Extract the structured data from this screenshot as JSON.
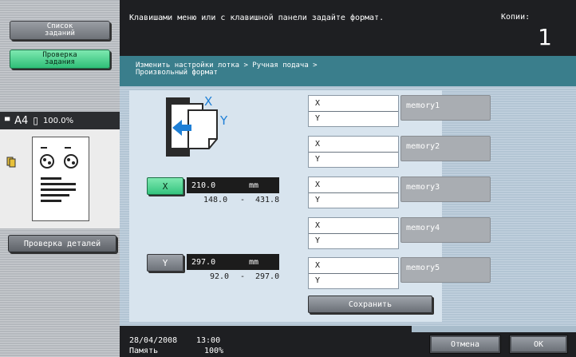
{
  "sidebar": {
    "job_list_label": "Список\nзаданий",
    "job_check_label": "Проверка\nзадания",
    "paper_size": "A4",
    "zoom": "100.0%",
    "details_label": "Проверка деталей"
  },
  "header": {
    "message": "Клавишами меню или с клавишной панели задайте формат.",
    "copies_label": "Копии:",
    "copies_value": "1"
  },
  "breadcrumb": {
    "line1": "Изменить настройки лотка > Ручная подача >",
    "line2": "Произвольный формат"
  },
  "diagram": {
    "x_label": "X",
    "y_label": "Y"
  },
  "x_setting": {
    "button_label": "X",
    "value": "210.0",
    "unit": "mm",
    "range_min": "148.0",
    "range_sep": "-",
    "range_max": "431.8"
  },
  "y_setting": {
    "button_label": "Y",
    "value": "297.0",
    "unit": "mm",
    "range_min": "92.0",
    "range_sep": "-",
    "range_max": "297.0"
  },
  "memories": [
    {
      "x_label": "X",
      "y_label": "Y",
      "name": "memory1"
    },
    {
      "x_label": "X",
      "y_label": "Y",
      "name": "memory2"
    },
    {
      "x_label": "X",
      "y_label": "Y",
      "name": "memory3"
    },
    {
      "x_label": "X",
      "y_label": "Y",
      "name": "memory4"
    },
    {
      "x_label": "X",
      "y_label": "Y",
      "name": "memory5"
    }
  ],
  "save_label": "Сохранить",
  "footer": {
    "date": "28/04/2008",
    "time": "13:00",
    "memory_label": "Память",
    "memory_value": "100%",
    "cancel_label": "Отмена",
    "ok_label": "OK"
  }
}
